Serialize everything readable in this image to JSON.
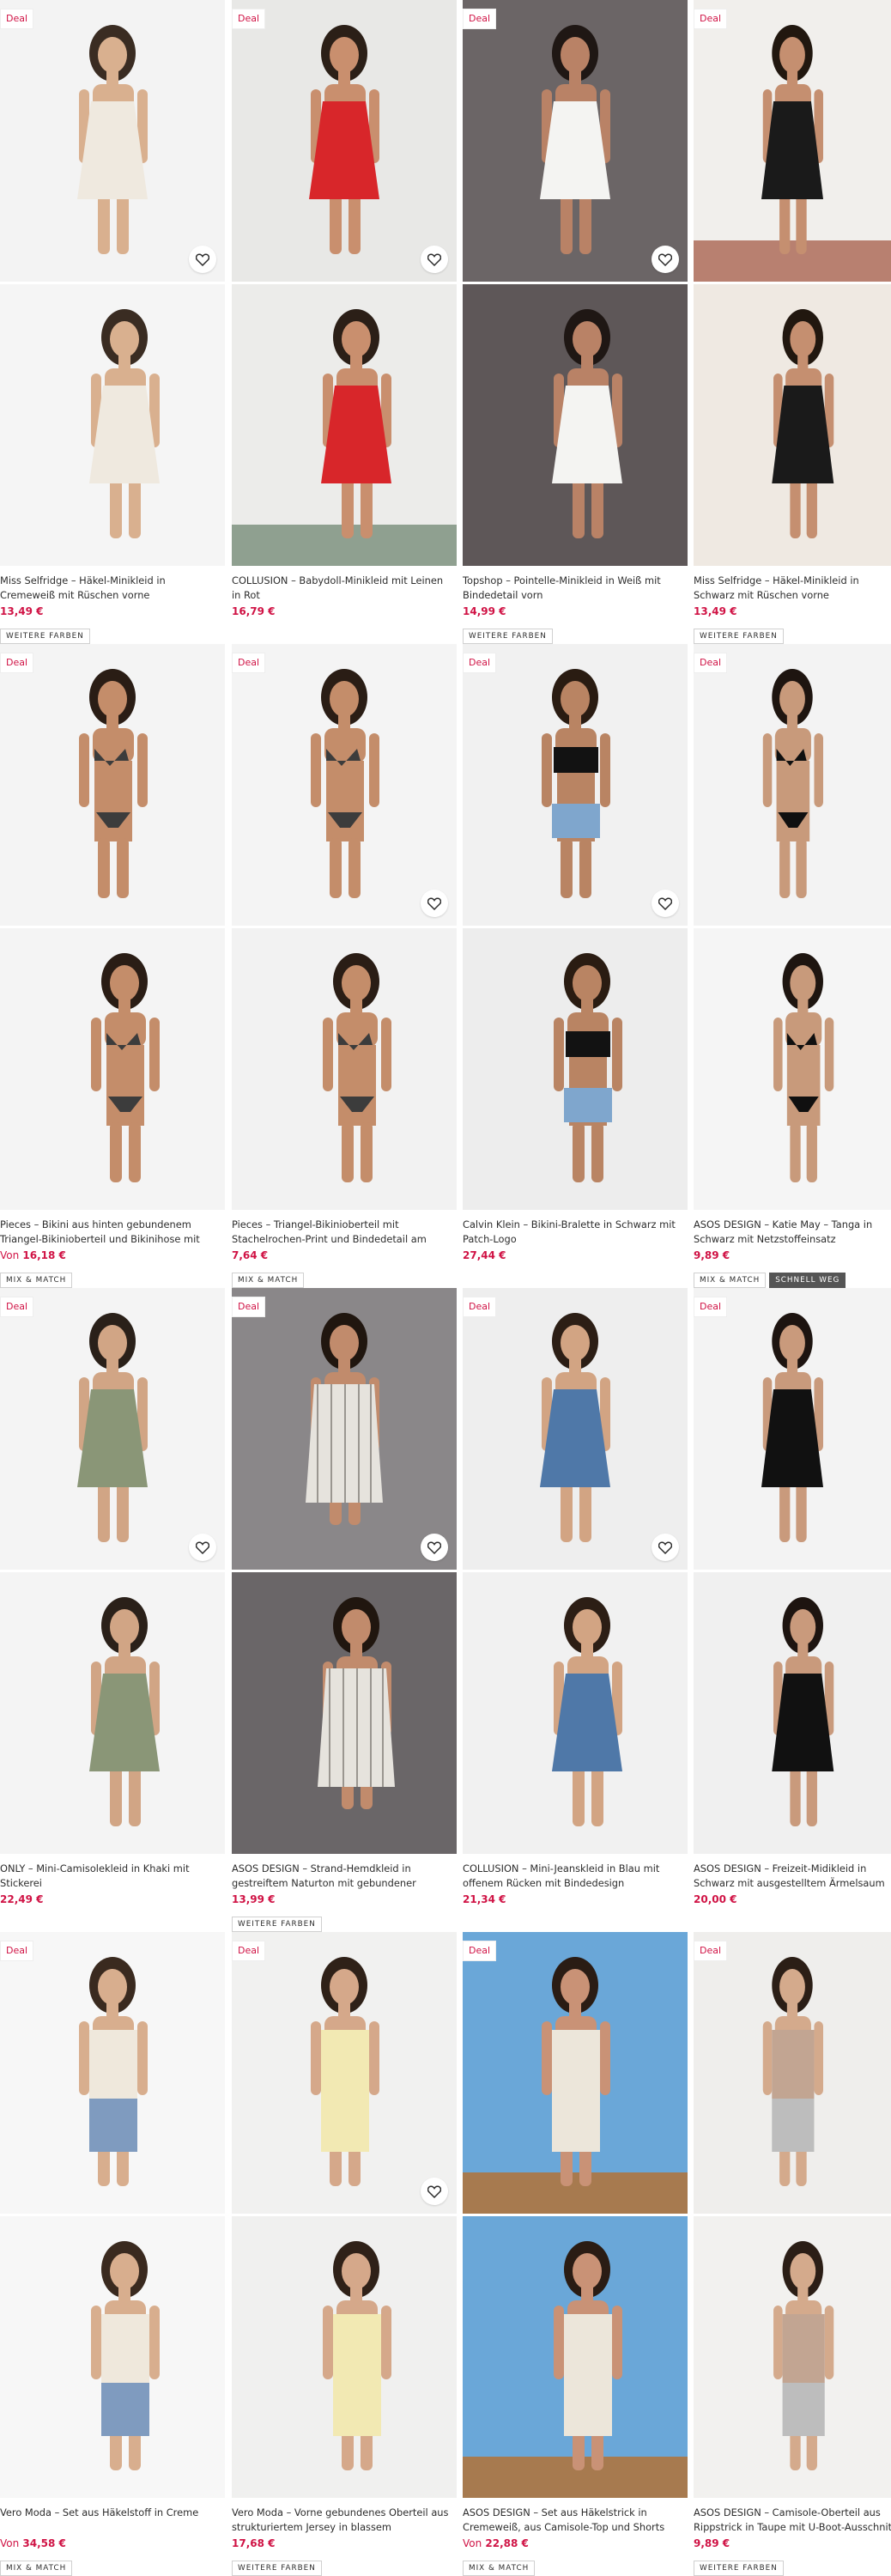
{
  "ui": {
    "deal_label": "Deal",
    "heart_icon": "heart-outline-icon",
    "accent_color": "#d01345"
  },
  "products": [
    {
      "title": "Miss Selfridge – Häkel-Minikleid in Cremeweiß mit Rüschen vorne",
      "price_prefix": "",
      "price": "13,49 €",
      "deal": true,
      "tags": [
        "WEITERE FARBEN"
      ]
    },
    {
      "title": "COLLUSION – Babydoll-Minikleid mit Leinen in Rot",
      "price_prefix": "",
      "price": "16,79 €",
      "deal": true,
      "tags": []
    },
    {
      "title": "Topshop – Pointelle-Minikleid in Weiß mit Bindedetail vorn",
      "price_prefix": "",
      "price": "14,99 €",
      "deal": true,
      "tags": [
        "WEITERE FARBEN"
      ]
    },
    {
      "title": "Miss Selfridge – Häkel-Minikleid in Schwarz mit Rüschen vorne",
      "price_prefix": "",
      "price": "13,49 €",
      "deal": true,
      "tags": [
        "WEITERE FARBEN"
      ]
    },
    {
      "title": "Pieces – Bikini aus hinten gebundenem Triangel-Bikinioberteil und Bikinihose mit Stachelrochen-Print",
      "price_prefix": "Von",
      "price": "16,18 €",
      "deal": true,
      "tags": [
        "MIX & MATCH"
      ]
    },
    {
      "title": "Pieces – Triangel-Bikinioberteil mit Stachelrochen-Print und Bindedetail am Rücken, Kombiteil",
      "price_prefix": "",
      "price": "7,64 €",
      "deal": true,
      "tags": [
        "MIX & MATCH"
      ]
    },
    {
      "title": "Calvin Klein – Bikini-Bralette in Schwarz mit Patch-Logo",
      "price_prefix": "",
      "price": "27,44 €",
      "deal": true,
      "tags": []
    },
    {
      "title": "ASOS DESIGN – Katie May – Tanga in Schwarz mit Netzstoffeinsatz",
      "price_prefix": "",
      "price": "9,89 €",
      "deal": true,
      "tags": [
        "MIX & MATCH",
        "SCHNELL WEG"
      ]
    },
    {
      "title": "ONLY – Mini-Camisolekleid in Khaki mit Stickerei",
      "price_prefix": "",
      "price": "22,49 €",
      "deal": true,
      "tags": []
    },
    {
      "title": "ASOS DESIGN – Strand-Hemdkleid in gestreiftem Naturton mit gebundener Vorderseite",
      "price_prefix": "",
      "price": "13,99 €",
      "deal": true,
      "tags": [
        "WEITERE FARBEN"
      ]
    },
    {
      "title": "COLLUSION – Mini-Jeanskleid in Blau mit offenem Rücken mit Bindedesign",
      "price_prefix": "",
      "price": "21,34 €",
      "deal": true,
      "tags": []
    },
    {
      "title": "ASOS DESIGN – Freizeit-Midikleid in Schwarz mit ausgestelltem Ärmelsaum und Knopfleiste vorn",
      "price_prefix": "",
      "price": "20,00 €",
      "deal": true,
      "tags": []
    },
    {
      "title": "Vero Moda – Set aus Häkelstoff in Creme",
      "price_prefix": "Von",
      "price": "34,58 €",
      "deal": true,
      "tags": [
        "MIX & MATCH"
      ]
    },
    {
      "title": "Vero Moda – Vorne gebundenes Oberteil aus strukturiertem Jersey in blassem Zitronengelb, ...",
      "price_prefix": "",
      "price": "17,68 €",
      "deal": true,
      "tags": [
        "WEITERE FARBEN"
      ]
    },
    {
      "title": "ASOS DESIGN – Set aus Häkelstrick in Cremeweiß, aus Camisole-Top und Shorts",
      "price_prefix": "Von",
      "price": "22,88 €",
      "deal": true,
      "tags": [
        "MIX & MATCH"
      ]
    },
    {
      "title": "ASOS DESIGN – Camisole-Oberteil aus Rippstrick in Taupe mit U-Boot-Ausschnitt",
      "price_prefix": "",
      "price": "9,89 €",
      "deal": true,
      "tags": [
        "WEITERE FARBEN"
      ]
    }
  ]
}
